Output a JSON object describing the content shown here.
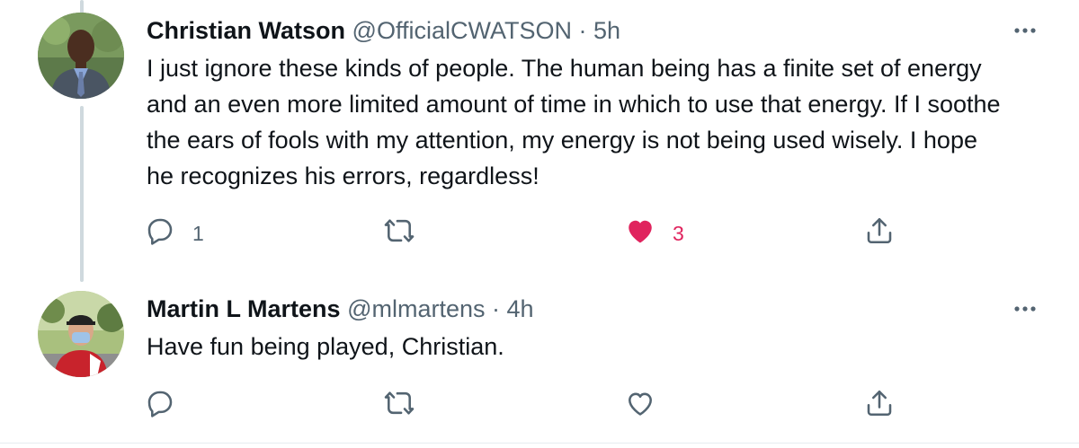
{
  "tweets": [
    {
      "author": {
        "name": "Christian Watson",
        "handle": "@OfficialCWATSON",
        "separator": "·",
        "time": "5h"
      },
      "text": "I just ignore these kinds of people. The human being has a finite set of energy and an even more limited amount of time in which to use that energy. If I soothe the ears of fools with my attention, my energy is not being used wisely. I hope he recognizes his errors, regardless!",
      "actions": {
        "reply_count": "1",
        "retweet_count": "",
        "like_count": "3",
        "liked": true
      },
      "icons": {
        "more": "more-horizontal-icon",
        "reply": "reply-icon",
        "retweet": "retweet-icon",
        "like": "heart-filled-icon",
        "share": "share-icon"
      }
    },
    {
      "author": {
        "name": "Martin L Martens",
        "handle": "@mlmartens",
        "separator": "·",
        "time": "4h"
      },
      "text": "Have fun being played, Christian.",
      "actions": {
        "reply_count": "",
        "retweet_count": "",
        "like_count": "",
        "liked": false
      },
      "icons": {
        "more": "more-horizontal-icon",
        "reply": "reply-icon",
        "retweet": "retweet-icon",
        "like": "heart-outline-icon",
        "share": "share-icon"
      }
    }
  ],
  "colors": {
    "text_primary": "#0f1419",
    "text_secondary": "#536471",
    "like_active": "#e0245e",
    "thread_line": "#cfd9de"
  }
}
